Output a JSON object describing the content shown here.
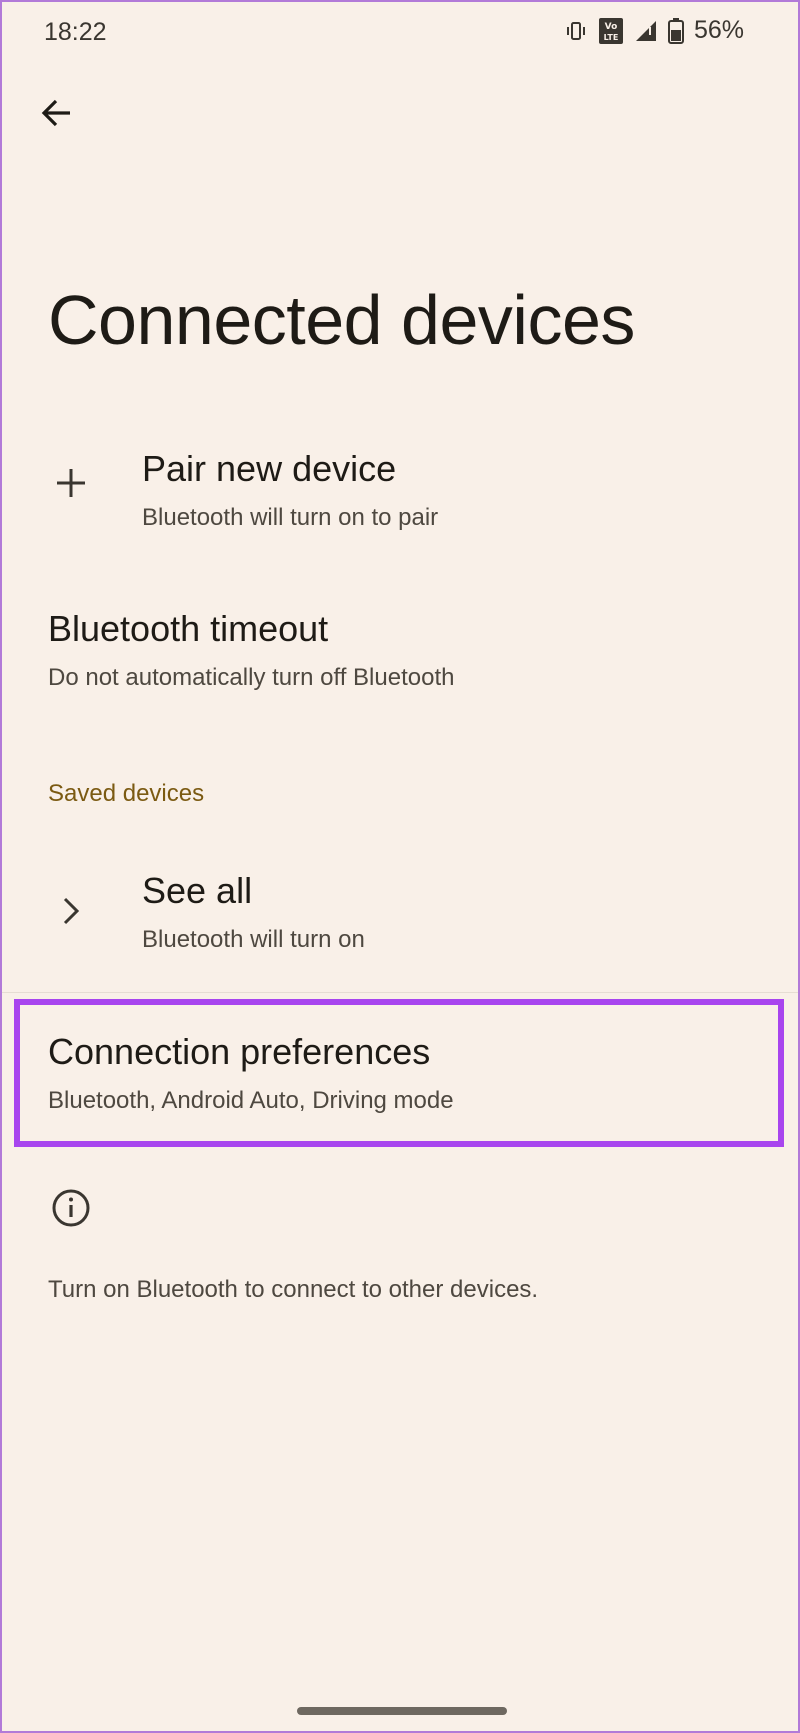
{
  "status_bar": {
    "time": "18:22",
    "battery": "56%",
    "icons": [
      "vibrate-icon",
      "volte-icon",
      "signal-icon",
      "battery-icon"
    ]
  },
  "header": {
    "back_icon": "arrow-left-icon",
    "title": "Connected devices"
  },
  "items": {
    "pair_new_device": {
      "icon": "plus-icon",
      "title": "Pair new device",
      "subtitle": "Bluetooth will turn on to pair"
    },
    "bluetooth_timeout": {
      "title": "Bluetooth timeout",
      "subtitle": "Do not automatically turn off Bluetooth"
    },
    "saved_devices_header": "Saved devices",
    "see_all": {
      "icon": "chevron-right-icon",
      "title": "See all",
      "subtitle": "Bluetooth will turn on"
    },
    "connection_preferences": {
      "title": "Connection preferences",
      "subtitle": "Bluetooth, Android Auto, Driving mode"
    }
  },
  "info": {
    "icon": "info-icon",
    "text": "Turn on Bluetooth to connect to other devices."
  },
  "colors": {
    "background": "#f9f0e8",
    "accent_section": "#7b5a12",
    "highlight_border": "#a845ee"
  }
}
